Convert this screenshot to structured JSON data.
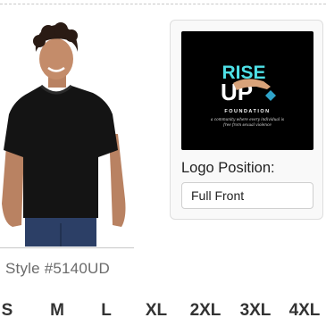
{
  "product": {
    "style_number": "Style #5140UD"
  },
  "logo_card": {
    "logo": {
      "brand_top": "RISE",
      "brand_bottom": "UP",
      "brand_sub": "FOUNDATION",
      "tagline_line1": "a community where every individual is",
      "tagline_line2": "free from sexual violence"
    },
    "position_label": "Logo Position:",
    "position_value": "Full Front"
  },
  "sizes": [
    "S",
    "M",
    "L",
    "XL",
    "2XL",
    "3XL",
    "4XL"
  ],
  "colors": {
    "shirt": "#141414",
    "logo_teal": "#4ee0e6",
    "card_border": "#dedede",
    "style_text": "#6b6b6b"
  }
}
